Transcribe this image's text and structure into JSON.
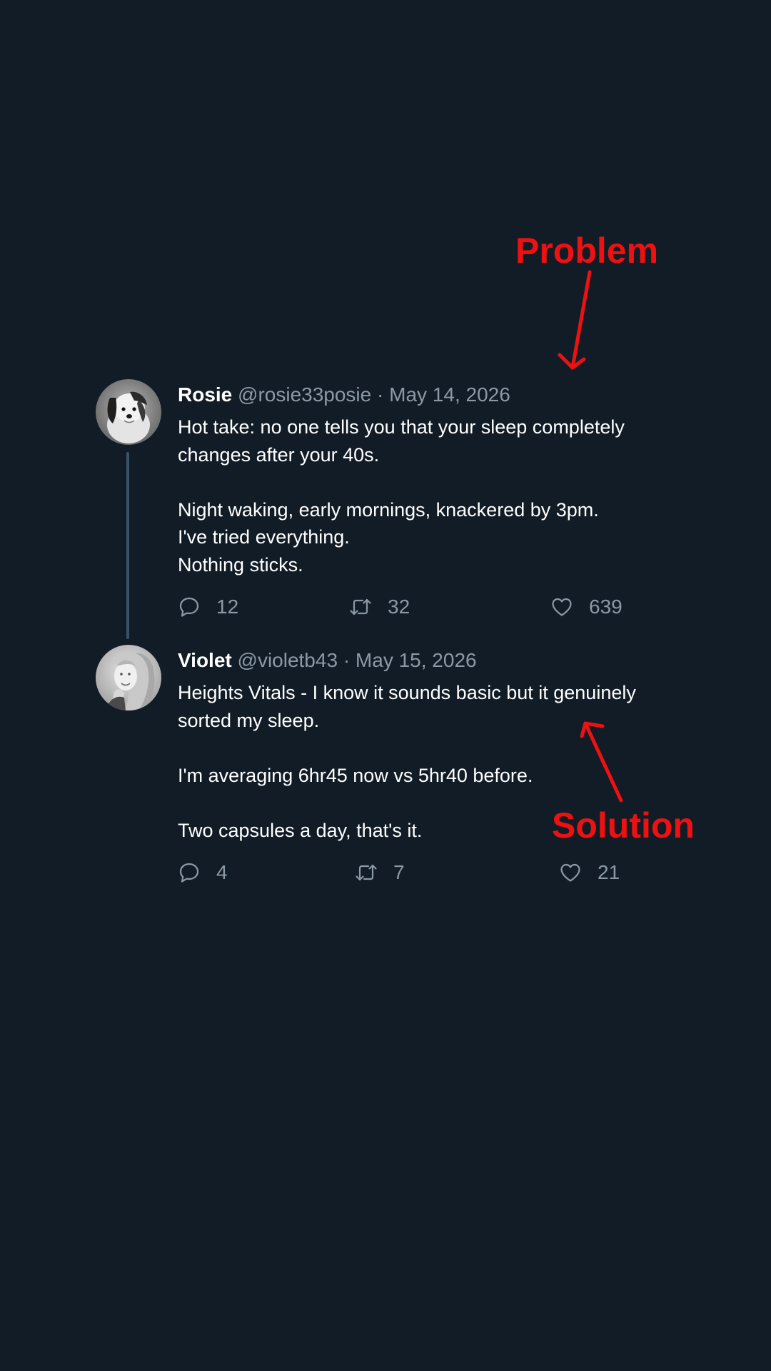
{
  "annotations": {
    "problem": "Problem",
    "solution": "Solution",
    "color": "#ee1111"
  },
  "colors": {
    "background": "#121c26",
    "text_primary": "#ffffff",
    "text_secondary": "#8b99a6",
    "thread_line": "#3a5166"
  },
  "tweets": [
    {
      "name": "Rosie",
      "handle": "@rosie33posie",
      "separator": "·",
      "date": "May 14, 2026",
      "avatar": "dog-avatar",
      "body": [
        "Hot take: no one tells you that your sleep completely changes after your 40s.",
        "",
        "Night waking, early mornings, knackered by 3pm.",
        "I've tried everything.",
        "Nothing sticks."
      ],
      "replies": "12",
      "retweets": "32",
      "likes": "639",
      "icons": [
        "reply-icon",
        "retweet-icon",
        "like-icon"
      ]
    },
    {
      "name": "Violet",
      "handle": "@violetb43",
      "separator": "·",
      "date": "May 15, 2026",
      "avatar": "woman-avatar",
      "body": [
        "Heights Vitals - I know it sounds basic but it genuinely sorted my sleep.",
        "",
        "I'm averaging 6hr45 now vs 5hr40 before.",
        "",
        "Two capsules a day, that's it."
      ],
      "replies": "4",
      "retweets": "7",
      "likes": "21",
      "icons": [
        "reply-icon",
        "retweet-icon",
        "like-icon"
      ]
    }
  ]
}
